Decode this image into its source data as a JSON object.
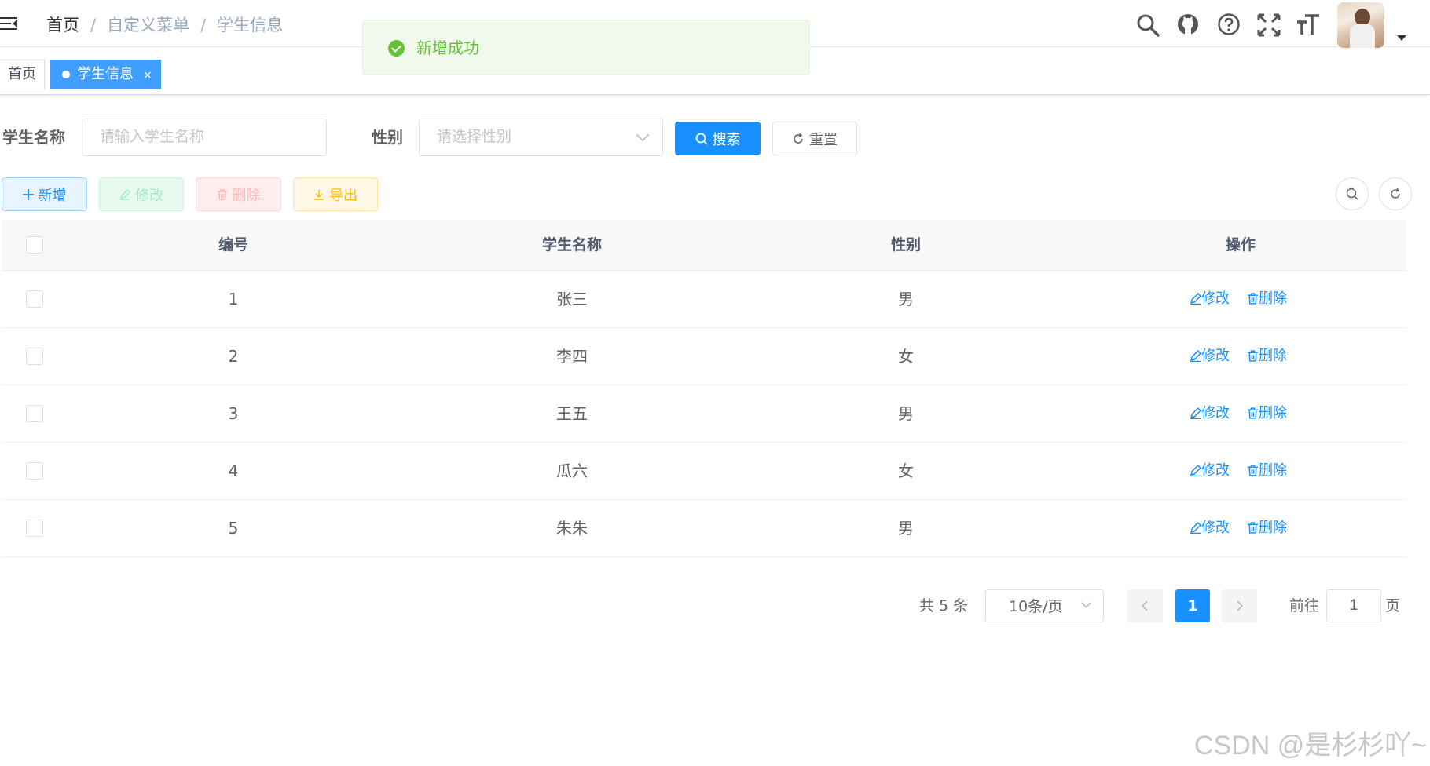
{
  "breadcrumb": {
    "home": "首页",
    "separator": "/",
    "level1": "自定义菜单",
    "level2": "学生信息"
  },
  "toast": {
    "text": "新增成功",
    "icon": "success-check-icon",
    "color": "#67c23a"
  },
  "header_tools": [
    "search-icon",
    "github-icon",
    "help-icon",
    "fullscreen-icon",
    "font-size-icon"
  ],
  "tags": [
    {
      "label": "首页",
      "close": ""
    },
    {
      "label": "学生信息",
      "close": "×"
    }
  ],
  "search_form": {
    "name_label": "学生名称",
    "name_placeholder": "请输入学生名称",
    "gender_label": "性别",
    "gender_placeholder": "请选择性别",
    "search_button": "搜索",
    "reset_button": "重置"
  },
  "toolbar": {
    "add": "新增",
    "edit": "修改",
    "delete": "删除",
    "export": "导出"
  },
  "table": {
    "columns": [
      "编号",
      "学生名称",
      "性别",
      "操作"
    ],
    "rows": [
      {
        "id": "1",
        "name": "张三",
        "gender": "男"
      },
      {
        "id": "2",
        "name": "李四",
        "gender": "女"
      },
      {
        "id": "3",
        "name": "王五",
        "gender": "男"
      },
      {
        "id": "4",
        "name": "瓜六",
        "gender": "女"
      },
      {
        "id": "5",
        "name": "朱朱",
        "gender": "男"
      }
    ],
    "row_actions": {
      "edit": "修改",
      "delete": "删除"
    }
  },
  "pagination": {
    "total_text": "共 5 条",
    "page_size": "10条/页",
    "current_page": "1",
    "goto_label": "前往",
    "goto_value": "1",
    "page_suffix": "页"
  },
  "watermark": "CSDN @是杉杉吖~",
  "colors": {
    "primary": "#1890ff",
    "success": "#67c23a"
  }
}
